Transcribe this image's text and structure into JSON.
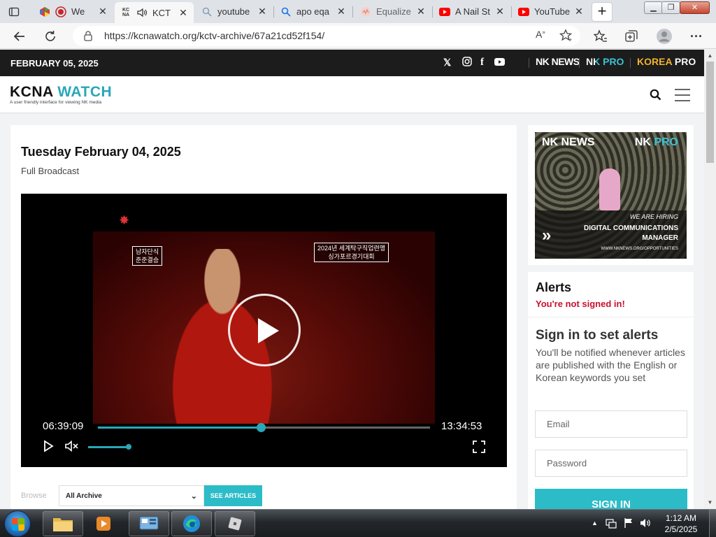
{
  "browser": {
    "tabs": [
      {
        "title": "We",
        "icon": "multicolor-app-icon"
      },
      {
        "title": "KCT",
        "icon": "kcna-icon"
      },
      {
        "title": "youtube",
        "icon": "search-icon"
      },
      {
        "title": "apo eqa",
        "icon": "search-icon"
      },
      {
        "title": "Equalize",
        "icon": "equalizer-icon"
      },
      {
        "title": "A Nail St",
        "icon": "youtube-icon"
      },
      {
        "title": "YouTube",
        "icon": "youtube-icon"
      }
    ],
    "url": "https://kcnawatch.org/kctv-archive/67a21cd52f154/"
  },
  "site": {
    "date_bar": "FEBRUARY 05, 2025",
    "brands": [
      "NK NEWS",
      "NK PRO",
      "KOREA PRO"
    ],
    "logo_part1": "KCNA",
    "logo_part2": "WATCH",
    "tagline": "A user friendly interface for viewing NK media"
  },
  "article": {
    "date_heading": "Tuesday February 04, 2025",
    "subheading": "Full Broadcast"
  },
  "video": {
    "current_time": "06:39:09",
    "duration": "13:34:53",
    "progress": 0.49,
    "caption_left": [
      "남자단식",
      "준준결승"
    ],
    "caption_right": [
      "2024년 세계탁구직업련맹",
      "싱가포르경기대회"
    ]
  },
  "browse": {
    "label": "Browse",
    "selected": "All Archive",
    "button": "SEE ARTICLES"
  },
  "ad": {
    "nk": "NK NEWS",
    "pro": "NK PRO",
    "hiring": "WE ARE HIRING",
    "title": "DIGITAL COMMUNICATIONS MANAGER",
    "url": "WWW.NKNEWS.ORG/OPPORTUNITIES"
  },
  "alerts": {
    "heading": "Alerts",
    "warning": "You're not signed in!",
    "signin_heading": "Sign in to set alerts",
    "signin_text": "You'll be notified whenever articles are published with the English or Korean keywords you set",
    "email_placeholder": "Email",
    "password_placeholder": "Password",
    "signin_button": "SIGN IN"
  },
  "taskbar": {
    "time": "1:12 AM",
    "date": "2/5/2025"
  },
  "colors": {
    "accent": "#2aa7b8",
    "button": "#2bbcc7",
    "warning": "#c8102e",
    "topbar": "#1c1c1c"
  }
}
